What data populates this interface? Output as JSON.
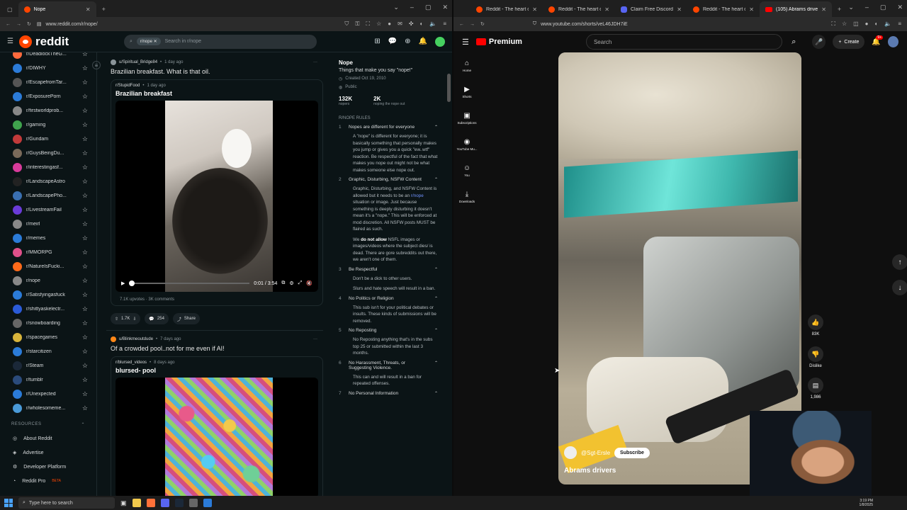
{
  "left_browser": {
    "tabs": [
      {
        "label": "Nope"
      }
    ],
    "url": "www.reddit.com/r/nope/"
  },
  "reddit": {
    "logo": "reddit",
    "search_chip": "r/nope",
    "search_placeholder": "Search in r/nope",
    "sidebar": [
      {
        "label": "r/DeadlockTheG...",
        "color": "#ff6a3d"
      },
      {
        "label": "r/DIWHY",
        "color": "#2b7bd8"
      },
      {
        "label": "r/EscapefromTar...",
        "color": "#555555"
      },
      {
        "label": "r/ExposurePorn",
        "color": "#2b7bd8"
      },
      {
        "label": "r/firstworldprob...",
        "color": "#888888"
      },
      {
        "label": "r/gaming",
        "color": "#3fa34d"
      },
      {
        "label": "r/Gundam",
        "color": "#c23a3a"
      },
      {
        "label": "r/GuysBeingDu...",
        "color": "#7a6a5a"
      },
      {
        "label": "r/interestingasf...",
        "color": "#d83b9b"
      },
      {
        "label": "r/LandscapeAstro",
        "color": "#222222"
      },
      {
        "label": "r/LandscapePho...",
        "color": "#3a6fb0"
      },
      {
        "label": "r/LivestreamFail",
        "color": "#6a3bd8"
      },
      {
        "label": "r/meirl",
        "color": "#888888"
      },
      {
        "label": "r/memes",
        "color": "#2b7bd8"
      },
      {
        "label": "r/MMORPG",
        "color": "#e0508a"
      },
      {
        "label": "r/NatureIsFucki...",
        "color": "#ff6a1a"
      },
      {
        "label": "r/nope",
        "color": "#888888"
      },
      {
        "label": "r/Satisfyingasfuck",
        "color": "#2b7bd8"
      },
      {
        "label": "r/shittyaskelectr...",
        "color": "#2b5bd8"
      },
      {
        "label": "r/snowboarding",
        "color": "#666666"
      },
      {
        "label": "r/spacegames",
        "color": "#d8b43b"
      },
      {
        "label": "r/starcitizen",
        "color": "#2b7bd8"
      },
      {
        "label": "r/Steam",
        "color": "#1b2838"
      },
      {
        "label": "r/tumblr",
        "color": "#2b4b7b"
      },
      {
        "label": "r/Unexpected",
        "color": "#2b7bd8"
      },
      {
        "label": "r/wholesomeme...",
        "color": "#4a9ad8"
      }
    ],
    "resources_header": "RESOURCES",
    "resources": [
      {
        "label": "About Reddit"
      },
      {
        "label": "Advertise"
      },
      {
        "label": "Developer Platform"
      },
      {
        "label": "Reddit Pro",
        "badge": "BETA"
      }
    ],
    "posts": [
      {
        "author": "u/Spiritual_Bridge84",
        "time": "1 day ago",
        "title": "Brazilian breakfast. What is that oil.",
        "crosspost_sub": "r/StupidFood",
        "crosspost_time": "1 day ago",
        "crosspost_title": "Brazilian breakfast",
        "video_time": "0:01 / 3:54",
        "upvotes": "7.1K upvotes",
        "comments_stat": "3K comments",
        "votes": "1.7K",
        "comments": "254",
        "share": "Share"
      },
      {
        "author": "u/Blinkmeoutdude",
        "time": "7 days ago",
        "title": "Of a crowded pool..not for me even if AI!",
        "crosspost_sub": "r/blursed_videos",
        "crosspost_time": "8 days ago",
        "crosspost_title": "blursed- pool"
      }
    ],
    "about": {
      "name": "Nope",
      "desc": "Things that make you say \"nope!\"",
      "created": "Created Oct 19, 2010",
      "visibility": "Public",
      "members": "132K",
      "members_label": "nopers",
      "online": "2K",
      "online_label": "noping the nope out"
    },
    "rules_header": "R/NOPE RULES",
    "rules": [
      {
        "n": "1",
        "title": "Nopes are different for everyone",
        "body": "A \"nope\" is different for everyone; it is basically something that personally makes you jump or gives you a quick \"ew..wtf\" reaction. Be respectful of the fact that what makes you nope out might not be what makes someone else nope out."
      },
      {
        "n": "2",
        "title": "Graphic, Disturbing, NSFW Content",
        "body_a": "Graphic, Disturbing, and NSFW Content is allowed but it needs to be an",
        "body_link": "r/nope",
        "body_b": "situation or image. Just because something is deeply disturbing it doesn't mean it's a \"nope.\" This will be enforced at mod discretion. All NSFW posts MUST be flaired as such.",
        "body2_a": "We",
        "body2_bold": "do not allow",
        "body2_b": "NSFL images or images/videos where the subject dies/ is dead. There are gore subreddits out there, we aren't one of them."
      },
      {
        "n": "3",
        "title": "Be Respectful",
        "body": "Don't be a dick to other users.",
        "body2": "Slurs and hate speech will result in a ban."
      },
      {
        "n": "4",
        "title": "No Politics or Religion",
        "body": "This sub isn't for your political debates or insults. These kinds of submissions will be removed."
      },
      {
        "n": "5",
        "title": "No Reposting",
        "body": "No Reposting anything that's in the subs top 25 or submitted within the last 3 months."
      },
      {
        "n": "6",
        "title": "No Harassment, Threats, or Suggesting Violence.",
        "body": "This can and will result in a ban for repeated offenses."
      },
      {
        "n": "7",
        "title": "No Personal Information"
      }
    ]
  },
  "right_browser": {
    "tabs": [
      {
        "label": "Reddit - The heart of th",
        "kind": "reddit"
      },
      {
        "label": "Reddit - The heart of th",
        "kind": "reddit"
      },
      {
        "label": "Claim Free Discord Tool",
        "kind": "discord"
      },
      {
        "label": "Reddit - The heart of th",
        "kind": "reddit"
      },
      {
        "label": "(105) Abrams drive",
        "kind": "youtube"
      }
    ],
    "url": "www.youtube.com/shorts/veL46JDH7iE"
  },
  "youtube": {
    "logo": "Premium",
    "search_placeholder": "Search",
    "create_label": "Create",
    "notif_count": "9+",
    "nav": [
      {
        "label": "Home",
        "glyph": "⌂"
      },
      {
        "label": "Shorts",
        "glyph": "▶"
      },
      {
        "label": "Subscriptions",
        "glyph": "▣"
      },
      {
        "label": "YouTube Mu...",
        "glyph": "◉"
      },
      {
        "label": "You",
        "glyph": "☺"
      },
      {
        "label": "Downloads",
        "glyph": "⤓"
      }
    ],
    "short": {
      "channel": "@Sgt-Ersle",
      "subscribe": "Subscribe",
      "title": "Abrams drivers"
    },
    "likes": "83K",
    "dislike": "Dislike",
    "comments": "1,986"
  },
  "taskbar": {
    "search": "Type here to search",
    "time": "3:19 PM",
    "date": "1/8/2025"
  }
}
